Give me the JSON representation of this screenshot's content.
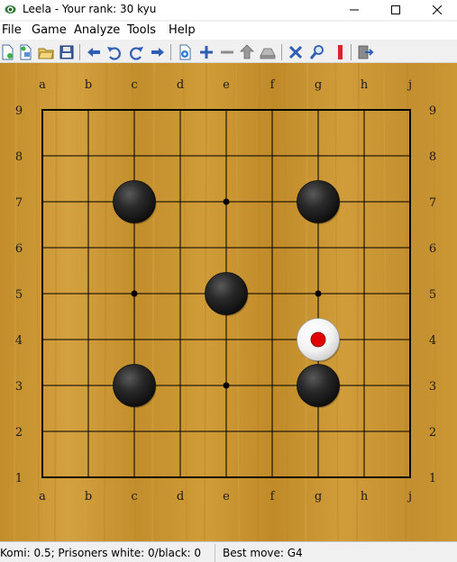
{
  "window": {
    "title": "Leela - Your rank: 30 kyu"
  },
  "menu": {
    "file": "File",
    "game": "Game",
    "analyze": "Analyze",
    "tools": "Tools",
    "help": "Help"
  },
  "toolbar": {
    "icons": [
      "new-game-icon",
      "new-setup-icon",
      "open-icon",
      "save-icon",
      "back-icon",
      "undo-icon",
      "redo-icon",
      "forward-icon",
      "settings-icon",
      "add-icon",
      "remove-icon",
      "upload-icon",
      "stack-icon",
      "resign-icon",
      "analyze-icon",
      "bookmark-icon",
      "exit-icon"
    ]
  },
  "board": {
    "size": 9,
    "columns": [
      "a",
      "b",
      "c",
      "d",
      "e",
      "f",
      "g",
      "h",
      "j"
    ],
    "rows": [
      "9",
      "8",
      "7",
      "6",
      "5",
      "4",
      "3",
      "2",
      "1"
    ],
    "star_points": [
      "e7",
      "c5",
      "g5",
      "e3"
    ],
    "stones": [
      {
        "point": "c7",
        "color": "black"
      },
      {
        "point": "g7",
        "color": "black"
      },
      {
        "point": "e5",
        "color": "black"
      },
      {
        "point": "g4",
        "color": "white",
        "last_move": true
      },
      {
        "point": "c3",
        "color": "black"
      },
      {
        "point": "g3",
        "color": "black"
      }
    ],
    "colors": {
      "wood": "#c9962f",
      "line": "#000000",
      "last_move_marker": "#e00000"
    }
  },
  "status": {
    "komi_text": "Komi: 0.5; Prisoners white: 0/black: 0",
    "best_move_text": "Best move: G4"
  }
}
